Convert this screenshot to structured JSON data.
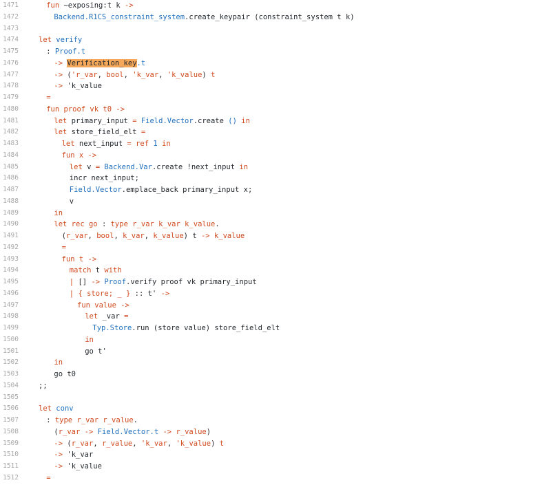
{
  "colors": {
    "keyword": "#d14a1e",
    "module": "#1f6fbd",
    "text": "#24292e",
    "line_number": "#a8a8a8",
    "search_highlight": "#f5a85a",
    "background": "#ffffff"
  },
  "lines": [
    {
      "n": "1471",
      "indent": 1,
      "tokens": [
        [
          "kw",
          "fun"
        ],
        [
          "p",
          " ~exposing:t k "
        ],
        [
          "kw",
          "->"
        ]
      ]
    },
    {
      "n": "1472",
      "indent": 2,
      "tokens": [
        [
          "mod",
          "Backend.R1CS_constraint_system"
        ],
        [
          "p",
          ".create_keypair (constraint_system t k)"
        ]
      ]
    },
    {
      "n": "1473",
      "indent": 0,
      "tokens": []
    },
    {
      "n": "1474",
      "indent": 0,
      "tokens": [
        [
          "kw",
          "let"
        ],
        [
          "p",
          " "
        ],
        [
          "mod",
          "verify"
        ]
      ]
    },
    {
      "n": "1475",
      "indent": 1,
      "tokens": [
        [
          "p",
          ": "
        ],
        [
          "mod",
          "Proof.t"
        ]
      ]
    },
    {
      "n": "1476",
      "indent": 2,
      "tokens": [
        [
          "kw",
          "->"
        ],
        [
          "p",
          " "
        ],
        [
          "hl",
          "Verification_key"
        ],
        [
          "mod",
          ".t"
        ]
      ]
    },
    {
      "n": "1477",
      "indent": 2,
      "tokens": [
        [
          "kw",
          "->"
        ],
        [
          "p",
          " ("
        ],
        [
          "kw",
          "'r_var"
        ],
        [
          "p",
          ", "
        ],
        [
          "kw",
          "bool"
        ],
        [
          "p",
          ", "
        ],
        [
          "kw",
          "'k_var"
        ],
        [
          "p",
          ", "
        ],
        [
          "kw",
          "'k_value"
        ],
        [
          "p",
          ") "
        ],
        [
          "kw",
          "t"
        ]
      ]
    },
    {
      "n": "1478",
      "indent": 2,
      "tokens": [
        [
          "kw",
          "->"
        ],
        [
          "p",
          " 'k_value"
        ]
      ]
    },
    {
      "n": "1479",
      "indent": 1,
      "tokens": [
        [
          "kw",
          "="
        ]
      ]
    },
    {
      "n": "1480",
      "indent": 1,
      "tokens": [
        [
          "kw",
          "fun"
        ],
        [
          "p",
          " "
        ],
        [
          "kw",
          "proof"
        ],
        [
          "p",
          " "
        ],
        [
          "kw",
          "vk"
        ],
        [
          "p",
          " "
        ],
        [
          "kw",
          "t0"
        ],
        [
          "p",
          " "
        ],
        [
          "kw",
          "->"
        ]
      ]
    },
    {
      "n": "1481",
      "indent": 2,
      "tokens": [
        [
          "kw",
          "let"
        ],
        [
          "p",
          " primary_input "
        ],
        [
          "kw",
          "="
        ],
        [
          "p",
          " "
        ],
        [
          "mod",
          "Field.Vector"
        ],
        [
          "p",
          ".create "
        ],
        [
          "mod",
          "()"
        ],
        [
          "p",
          " "
        ],
        [
          "kw",
          "in"
        ]
      ]
    },
    {
      "n": "1482",
      "indent": 2,
      "tokens": [
        [
          "kw",
          "let"
        ],
        [
          "p",
          " store_field_elt "
        ],
        [
          "kw",
          "="
        ]
      ]
    },
    {
      "n": "1483",
      "indent": 3,
      "tokens": [
        [
          "kw",
          "let"
        ],
        [
          "p",
          " next_input "
        ],
        [
          "kw",
          "="
        ],
        [
          "p",
          " "
        ],
        [
          "kw",
          "ref"
        ],
        [
          "p",
          " "
        ],
        [
          "mod",
          "1"
        ],
        [
          "p",
          " "
        ],
        [
          "kw",
          "in"
        ]
      ]
    },
    {
      "n": "1484",
      "indent": 3,
      "tokens": [
        [
          "kw",
          "fun"
        ],
        [
          "p",
          " "
        ],
        [
          "kw",
          "x"
        ],
        [
          "p",
          " "
        ],
        [
          "kw",
          "->"
        ]
      ]
    },
    {
      "n": "1485",
      "indent": 4,
      "tokens": [
        [
          "kw",
          "let"
        ],
        [
          "p",
          " v "
        ],
        [
          "kw",
          "="
        ],
        [
          "p",
          " "
        ],
        [
          "mod",
          "Backend.Var"
        ],
        [
          "p",
          ".create !next_input "
        ],
        [
          "kw",
          "in"
        ]
      ]
    },
    {
      "n": "1486",
      "indent": 4,
      "tokens": [
        [
          "p",
          "incr next_input;"
        ]
      ]
    },
    {
      "n": "1487",
      "indent": 4,
      "tokens": [
        [
          "mod",
          "Field.Vector"
        ],
        [
          "p",
          ".emplace_back primary_input x;"
        ]
      ]
    },
    {
      "n": "1488",
      "indent": 4,
      "tokens": [
        [
          "p",
          "v"
        ]
      ]
    },
    {
      "n": "1489",
      "indent": 2,
      "tokens": [
        [
          "kw",
          "in"
        ]
      ]
    },
    {
      "n": "1490",
      "indent": 2,
      "tokens": [
        [
          "kw",
          "let rec"
        ],
        [
          "p",
          " "
        ],
        [
          "kw",
          "go"
        ],
        [
          "p",
          " : "
        ],
        [
          "kw",
          "type"
        ],
        [
          "p",
          " "
        ],
        [
          "kw",
          "r_var"
        ],
        [
          "p",
          " "
        ],
        [
          "kw",
          "k_var"
        ],
        [
          "p",
          " "
        ],
        [
          "kw",
          "k_value"
        ],
        [
          "p",
          "."
        ]
      ]
    },
    {
      "n": "1491",
      "indent": 3,
      "tokens": [
        [
          "p",
          "("
        ],
        [
          "kw",
          "r_var"
        ],
        [
          "p",
          ", "
        ],
        [
          "kw",
          "bool"
        ],
        [
          "p",
          ", "
        ],
        [
          "kw",
          "k_var"
        ],
        [
          "p",
          ", "
        ],
        [
          "kw",
          "k_value"
        ],
        [
          "p",
          ") t "
        ],
        [
          "kw",
          "->"
        ],
        [
          "p",
          " "
        ],
        [
          "kw",
          "k_value"
        ]
      ]
    },
    {
      "n": "1492",
      "indent": 3,
      "tokens": [
        [
          "kw",
          "="
        ]
      ]
    },
    {
      "n": "1493",
      "indent": 3,
      "tokens": [
        [
          "kw",
          "fun"
        ],
        [
          "p",
          " "
        ],
        [
          "kw",
          "t"
        ],
        [
          "p",
          " "
        ],
        [
          "kw",
          "->"
        ]
      ]
    },
    {
      "n": "1494",
      "indent": 4,
      "tokens": [
        [
          "kw",
          "match"
        ],
        [
          "p",
          " t "
        ],
        [
          "kw",
          "with"
        ]
      ]
    },
    {
      "n": "1495",
      "indent": 4,
      "tokens": [
        [
          "kw",
          "|"
        ],
        [
          "p",
          " [] "
        ],
        [
          "kw",
          "->"
        ],
        [
          "p",
          " "
        ],
        [
          "mod",
          "Proof"
        ],
        [
          "p",
          ".verify proof vk primary_input"
        ]
      ]
    },
    {
      "n": "1496",
      "indent": 4,
      "tokens": [
        [
          "kw",
          "|"
        ],
        [
          "p",
          " "
        ],
        [
          "kw",
          "{ store; _ }"
        ],
        [
          "p",
          " :: t' "
        ],
        [
          "kw",
          "->"
        ]
      ]
    },
    {
      "n": "1497",
      "indent": 5,
      "tokens": [
        [
          "kw",
          "fun"
        ],
        [
          "p",
          " "
        ],
        [
          "kw",
          "value"
        ],
        [
          "p",
          " "
        ],
        [
          "kw",
          "->"
        ]
      ]
    },
    {
      "n": "1498",
      "indent": 6,
      "tokens": [
        [
          "kw",
          "let"
        ],
        [
          "p",
          " _var "
        ],
        [
          "kw",
          "="
        ]
      ]
    },
    {
      "n": "1499",
      "indent": 7,
      "tokens": [
        [
          "mod",
          "Typ.Store"
        ],
        [
          "p",
          ".run (store value) store_field_elt"
        ]
      ]
    },
    {
      "n": "1500",
      "indent": 6,
      "tokens": [
        [
          "kw",
          "in"
        ]
      ]
    },
    {
      "n": "1501",
      "indent": 6,
      "tokens": [
        [
          "p",
          "go t'"
        ]
      ]
    },
    {
      "n": "1502",
      "indent": 2,
      "tokens": [
        [
          "kw",
          "in"
        ]
      ]
    },
    {
      "n": "1503",
      "indent": 2,
      "tokens": [
        [
          "p",
          "go t0"
        ]
      ]
    },
    {
      "n": "1504",
      "indent": 0,
      "tokens": [
        [
          "p",
          ";;"
        ]
      ]
    },
    {
      "n": "1505",
      "indent": 0,
      "tokens": []
    },
    {
      "n": "1506",
      "indent": 0,
      "tokens": [
        [
          "kw",
          "let"
        ],
        [
          "p",
          " "
        ],
        [
          "mod",
          "conv"
        ]
      ]
    },
    {
      "n": "1507",
      "indent": 1,
      "tokens": [
        [
          "p",
          ": "
        ],
        [
          "kw",
          "type"
        ],
        [
          "p",
          " "
        ],
        [
          "kw",
          "r_var"
        ],
        [
          "p",
          " "
        ],
        [
          "kw",
          "r_value"
        ],
        [
          "p",
          "."
        ]
      ]
    },
    {
      "n": "1508",
      "indent": 2,
      "tokens": [
        [
          "p",
          "("
        ],
        [
          "kw",
          "r_var"
        ],
        [
          "p",
          " "
        ],
        [
          "kw",
          "->"
        ],
        [
          "p",
          " "
        ],
        [
          "mod",
          "Field.Vector.t"
        ],
        [
          "p",
          " "
        ],
        [
          "kw",
          "->"
        ],
        [
          "p",
          " "
        ],
        [
          "kw",
          "r_value"
        ],
        [
          "p",
          ")"
        ]
      ]
    },
    {
      "n": "1509",
      "indent": 2,
      "tokens": [
        [
          "kw",
          "->"
        ],
        [
          "p",
          " ("
        ],
        [
          "kw",
          "r_var"
        ],
        [
          "p",
          ", "
        ],
        [
          "kw",
          "r_value"
        ],
        [
          "p",
          ", "
        ],
        [
          "kw",
          "'k_var"
        ],
        [
          "p",
          ", "
        ],
        [
          "kw",
          "'k_value"
        ],
        [
          "p",
          ") "
        ],
        [
          "kw",
          "t"
        ]
      ]
    },
    {
      "n": "1510",
      "indent": 2,
      "tokens": [
        [
          "kw",
          "->"
        ],
        [
          "p",
          " 'k_var"
        ]
      ]
    },
    {
      "n": "1511",
      "indent": 2,
      "tokens": [
        [
          "kw",
          "->"
        ],
        [
          "p",
          " 'k_value"
        ]
      ]
    },
    {
      "n": "1512",
      "indent": 1,
      "tokens": [
        [
          "kw",
          "="
        ]
      ]
    }
  ]
}
